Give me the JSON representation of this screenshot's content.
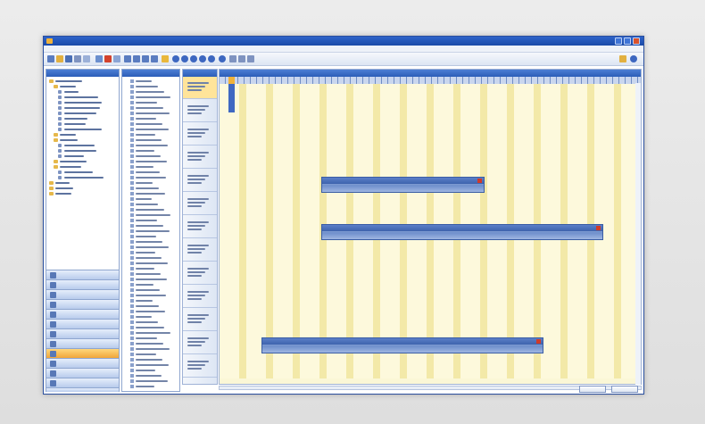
{
  "window": {
    "title": "",
    "menu": [
      "",
      "",
      "",
      "",
      ""
    ]
  },
  "left_pane": {
    "header": "",
    "nav": [
      {
        "label": "",
        "active": false
      },
      {
        "label": "",
        "active": false
      },
      {
        "label": "",
        "active": false
      },
      {
        "label": "",
        "active": false
      },
      {
        "label": "",
        "active": false
      },
      {
        "label": "",
        "active": false
      },
      {
        "label": "",
        "active": false
      },
      {
        "label": "",
        "active": false
      },
      {
        "label": "",
        "active": true
      },
      {
        "label": "",
        "active": false
      },
      {
        "label": "",
        "active": false
      },
      {
        "label": "",
        "active": false
      },
      {
        "label": "",
        "active": false
      }
    ]
  },
  "mid_pane": {
    "header": ""
  },
  "resource_column": {
    "header": ""
  },
  "gantt": {
    "bars": [
      {
        "title": "",
        "subtitle": ""
      },
      {
        "title": "",
        "subtitle": ""
      },
      {
        "title": "",
        "subtitle": ""
      },
      {
        "title": "",
        "subtitle": ""
      }
    ]
  },
  "footer": {
    "buttons": [
      "",
      ""
    ]
  },
  "colors": {
    "titlebar": "#1a4aa8",
    "gantt_bg": "#fbf7d6",
    "gantt_stripe": "#f3e9a8",
    "active_nav": "#f0a63a"
  }
}
